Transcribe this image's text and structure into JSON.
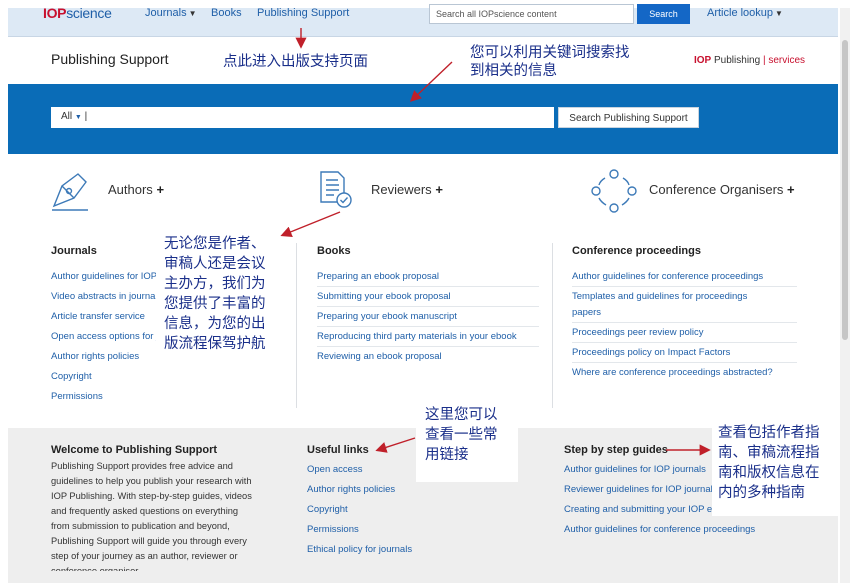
{
  "topnav": {
    "logo_prefix": "IOP",
    "logo_suffix": "science",
    "journals": "Journals",
    "books": "Books",
    "publishing_support": "Publishing Support",
    "search_placeholder": "Search all IOPscience content",
    "search_button": "Search",
    "article_lookup": "Article lookup"
  },
  "header": {
    "title": "Publishing Support",
    "brand_bold": "IOP",
    "brand_word": "Publishing",
    "brand_sep": "|",
    "brand_services": "services"
  },
  "hero": {
    "scope": "All",
    "input_value": "|",
    "button": "Search Publishing Support"
  },
  "categories": [
    {
      "label": "Authors",
      "plus": "+"
    },
    {
      "label": "Reviewers",
      "plus": "+"
    },
    {
      "label": "Conference Organisers",
      "plus": "+"
    }
  ],
  "journals": {
    "heading": "Journals",
    "links": [
      "Author guidelines for IOP journals",
      "Video abstracts in journals",
      "Article transfer service",
      "Open access options for journals",
      "Author rights policies",
      "Copyright",
      "Permissions"
    ]
  },
  "books": {
    "heading": "Books",
    "links": [
      "Preparing an ebook proposal",
      "Submitting your ebook proposal",
      "Preparing your ebook manuscript",
      "Reproducing third party materials in your ebook",
      "Reviewing an ebook proposal"
    ]
  },
  "conference": {
    "heading": "Conference proceedings",
    "links": [
      "Author guidelines for conference proceedings",
      "Templates and guidelines for proceedings",
      "papers",
      "Proceedings peer review policy",
      "Proceedings policy on Impact Factors",
      "Where are conference proceedings abstracted?"
    ]
  },
  "welcome": {
    "heading": "Welcome to Publishing Support",
    "lines": [
      "Publishing Support provides free advice and",
      "guidelines to help you publish your research with",
      "IOP Publishing. With step-by-step guides, videos",
      "and frequently asked questions on everything",
      "from submission to publication and beyond,",
      "Publishing Support will guide you through every",
      "step of your journey as an author, reviewer or",
      "conference organiser."
    ]
  },
  "useful_links": {
    "heading": "Useful links",
    "links": [
      "Open access",
      "Author rights policies",
      "Copyright",
      "Permissions",
      "Ethical policy for journals"
    ]
  },
  "guides": {
    "heading": "Step by step guides",
    "links": [
      "Author guidelines for IOP journals",
      "Reviewer guidelines for IOP journals",
      "Creating and submitting your IOP ebook",
      "Author guidelines for conference proceedings"
    ]
  },
  "annotations": {
    "enter_page": "点此进入出版支持页面",
    "search_tip_1": "您可以利用关键词搜索找",
    "search_tip_2": "到相关的信息",
    "roles_1": "无论您是作者、",
    "roles_2": "审稿人还是会议",
    "roles_3": "主办方，我们为",
    "roles_4": "您提供了丰富的",
    "roles_5": "信息，为您的出",
    "roles_6": "版流程保驾护航",
    "links_1": "这里您可以",
    "links_2": "查看一些常",
    "links_3": "用链接",
    "guides_1": "查看包括作者指",
    "guides_2": "南、审稿流程指",
    "guides_3": "南和版权信息在",
    "guides_4": "内的多种指南"
  },
  "colors": {
    "brand_blue": "#0a6cb7",
    "link_blue": "#1f5fa8",
    "iop_red": "#c8102e",
    "annotation_red": "#c0202a",
    "annotation_ink": "#1a2f8a"
  }
}
